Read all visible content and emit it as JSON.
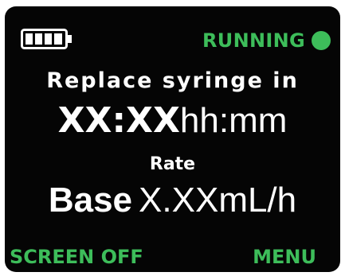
{
  "colors": {
    "accent": "#3dbd5a",
    "text": "#ffffff",
    "background": "#050505"
  },
  "header": {
    "battery_icon": "battery-full-icon",
    "battery_level": 1.0,
    "status_text": "RUNNING",
    "status_icon": "status-dot-icon"
  },
  "main": {
    "replace_label": "Replace syringe in",
    "time_value": "XX:XX",
    "time_unit": "hh:mm",
    "rate_label": "Rate",
    "rate_mode": "Base",
    "rate_value": "X.XX",
    "rate_unit": "mL/h"
  },
  "softkeys": {
    "left_label": "SCREEN OFF",
    "right_label": "MENU"
  }
}
